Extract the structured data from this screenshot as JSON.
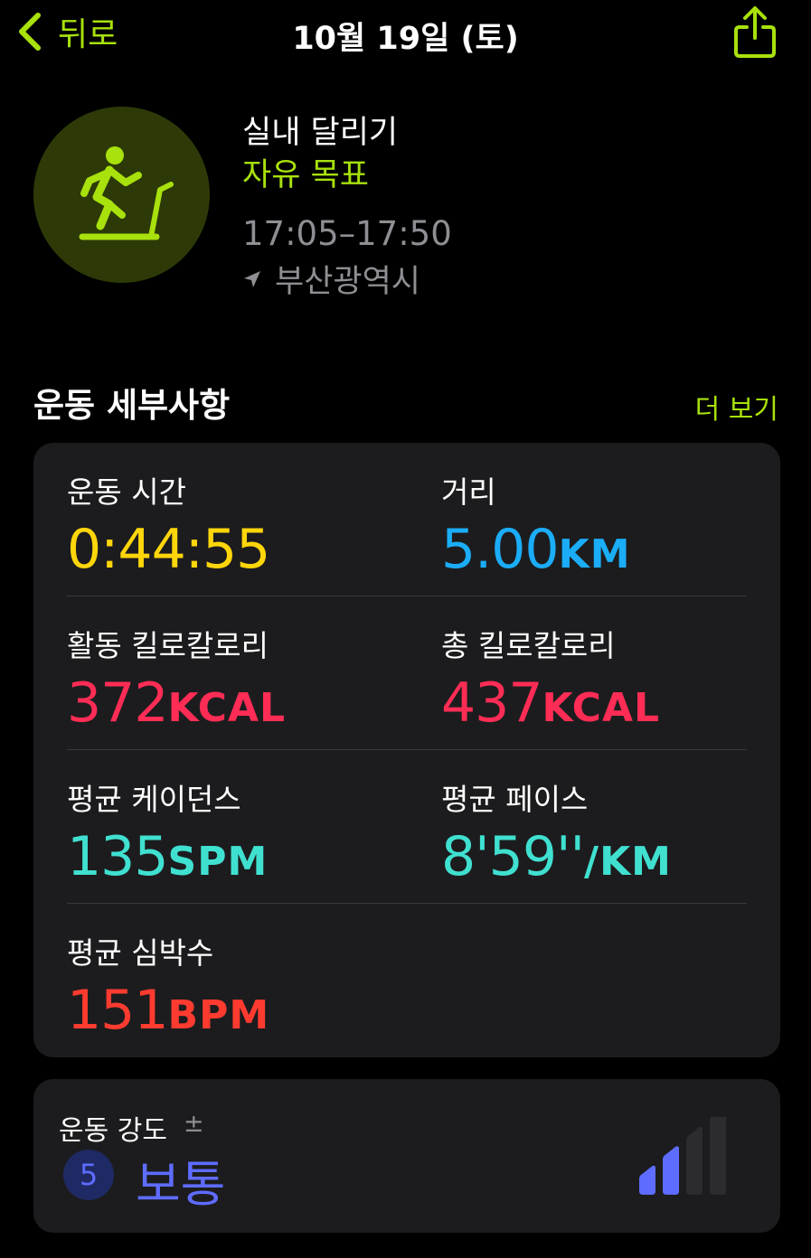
{
  "nav": {
    "back_label": "뒤로",
    "title": "10월 19일 (토)",
    "back_icon": "chevron-left-icon",
    "share_icon": "share-icon"
  },
  "workout": {
    "icon": "indoor-run-icon",
    "title": "실내 달리기",
    "goal": "자유 목표",
    "time_range": "17:05–17:50",
    "location": "부산광역시"
  },
  "details": {
    "section_title": "운동 세부사항",
    "more_label": "더 보기",
    "metrics": [
      {
        "label": "운동 시간",
        "value": "0:44:55",
        "unit": "",
        "color": "#ffd60a"
      },
      {
        "label": "거리",
        "value": "5.00",
        "unit": "KM",
        "color": "#1badf8"
      },
      {
        "label": "활동 킬로칼로리",
        "value": "372",
        "unit": "KCAL",
        "color": "#ff2d55"
      },
      {
        "label": "총 킬로칼로리",
        "value": "437",
        "unit": "KCAL",
        "color": "#ff2d55"
      },
      {
        "label": "평균 케이던스",
        "value": "135",
        "unit": "SPM",
        "color": "#40e0d0"
      },
      {
        "label": "평균 페이스",
        "value": "8'59''",
        "unit": "/KM",
        "color": "#40e0d0"
      },
      {
        "label": "평균 심박수",
        "value": "151",
        "unit": "BPM",
        "color": "#ff3b30"
      }
    ]
  },
  "intensity": {
    "label": "운동 강도",
    "plus_minus": "±",
    "level": "5",
    "value": "보통",
    "color": "#5e6cff",
    "bars_filled": 2,
    "bars_total": 4
  }
}
